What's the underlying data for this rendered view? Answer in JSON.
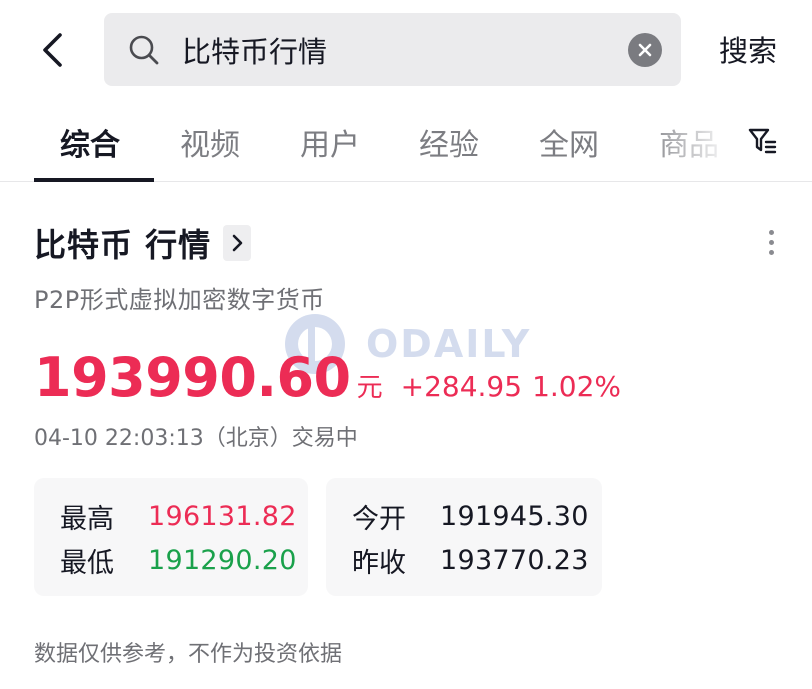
{
  "search": {
    "query": "比特币行情",
    "submit_label": "搜索"
  },
  "tabs": [
    {
      "label": "综合",
      "active": true
    },
    {
      "label": "视频",
      "active": false
    },
    {
      "label": "用户",
      "active": false
    },
    {
      "label": "经验",
      "active": false
    },
    {
      "label": "全网",
      "active": false
    },
    {
      "label": "商品",
      "active": false
    }
  ],
  "card": {
    "title": "比特币 行情",
    "subtitle": "P2P形式虚拟加密数字货币",
    "price": "193990.60",
    "unit": "元",
    "change": "+284.95",
    "change_pct": "1.02%",
    "timestamp": "04-10 22:03:13（北京）交易中",
    "stats_left": [
      {
        "label": "最高",
        "value": "196131.82",
        "trend": "up"
      },
      {
        "label": "最低",
        "value": "191290.20",
        "trend": "down"
      }
    ],
    "stats_right": [
      {
        "label": "今开",
        "value": "191945.30"
      },
      {
        "label": "昨收",
        "value": "193770.23"
      }
    ],
    "disclaimer": "数据仅供参考，不作为投资依据"
  },
  "watermark": {
    "text": "ODAILY"
  },
  "colors": {
    "up": "#ec2c55",
    "down": "#1aa14b",
    "text_primary": "#161823",
    "text_secondary": "#6f7075"
  },
  "icons": {
    "back": "chevron-left-icon",
    "search": "search-icon",
    "clear": "clear-icon",
    "filter": "filter-icon",
    "title_arrow": "chevron-right-icon",
    "more": "more-vertical-icon"
  }
}
